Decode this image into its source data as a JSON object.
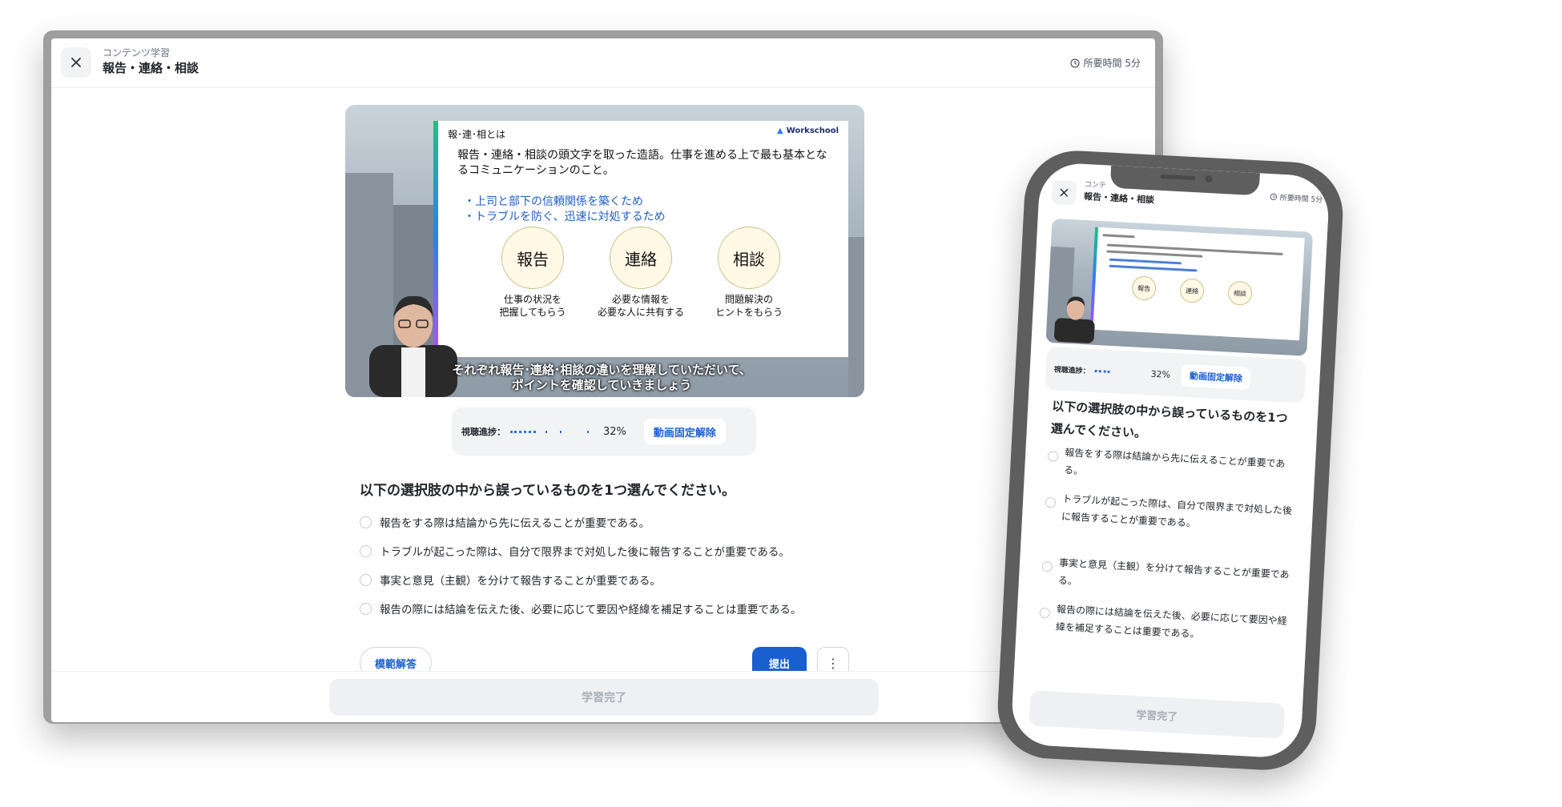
{
  "header": {
    "breadcrumb": "コンテンツ学習",
    "title": "報告・連絡・相談",
    "duration": "所要時間 5分"
  },
  "video": {
    "slide_heading": "報･連･相とは",
    "logo_text": "Workschool",
    "intro": "報告・連絡・相談の頭文字を取った造語。仕事を進める上で最も基本となるコミュニケーションのこと。",
    "bullets": [
      "・上司と部下の信頼関係を築くため",
      "・トラブルを防ぐ、迅速に対処するため"
    ],
    "circles": [
      {
        "label": "報告",
        "caption": "仕事の状況を\n把握してもらう"
      },
      {
        "label": "連絡",
        "caption": "必要な情報を\n必要な人に共有する"
      },
      {
        "label": "相談",
        "caption": "問題解決の\nヒントをもらう"
      }
    ],
    "subtitle": "それぞれ報告･連絡･相談の違いを理解していただいて、\nポイントを確認していきましょう"
  },
  "progress": {
    "label": "視聴進捗：",
    "percent": 32,
    "percent_text": "32%",
    "unlock_label": "動画固定解除"
  },
  "quiz": {
    "question": "以下の選択肢の中から誤っているものを1つ選んでください。",
    "options": [
      "報告をする際は結論から先に伝えることが重要である。",
      "トラブルが起こった際は、自分で限界まで対処した後に報告することが重要である。",
      "事実と意見（主観）を分けて報告することが重要である。",
      "報告の際には結論を伝えた後、必要に応じて要因や経緯を補足することは重要である。"
    ],
    "explain_label": "模範解答",
    "submit_label": "提出",
    "more_label": "⋮"
  },
  "footer": {
    "complete_label": "学習完了"
  },
  "phone": {
    "breadcrumb": "コンテ",
    "title": "報告・連絡・相談",
    "duration": "所要時間 5分",
    "question": "以下の選択肢の中から誤っているものを1つ選んでください。",
    "options": [
      "報告をする際は結論から先に伝えることが重要である。",
      "トラブルが起こった際は、自分で限界まで対処した後に報告することが重要である。",
      "事実と意見（主観）を分けて報告することが重要である。",
      "報告の際には結論を伝えた後、必要に応じて要因や経緯を補足することは重要である。"
    ]
  },
  "colors": {
    "accent": "#1a5fd0",
    "phone_frame": "#5e5e5e",
    "desktop_frame": "#9e9e9e"
  }
}
